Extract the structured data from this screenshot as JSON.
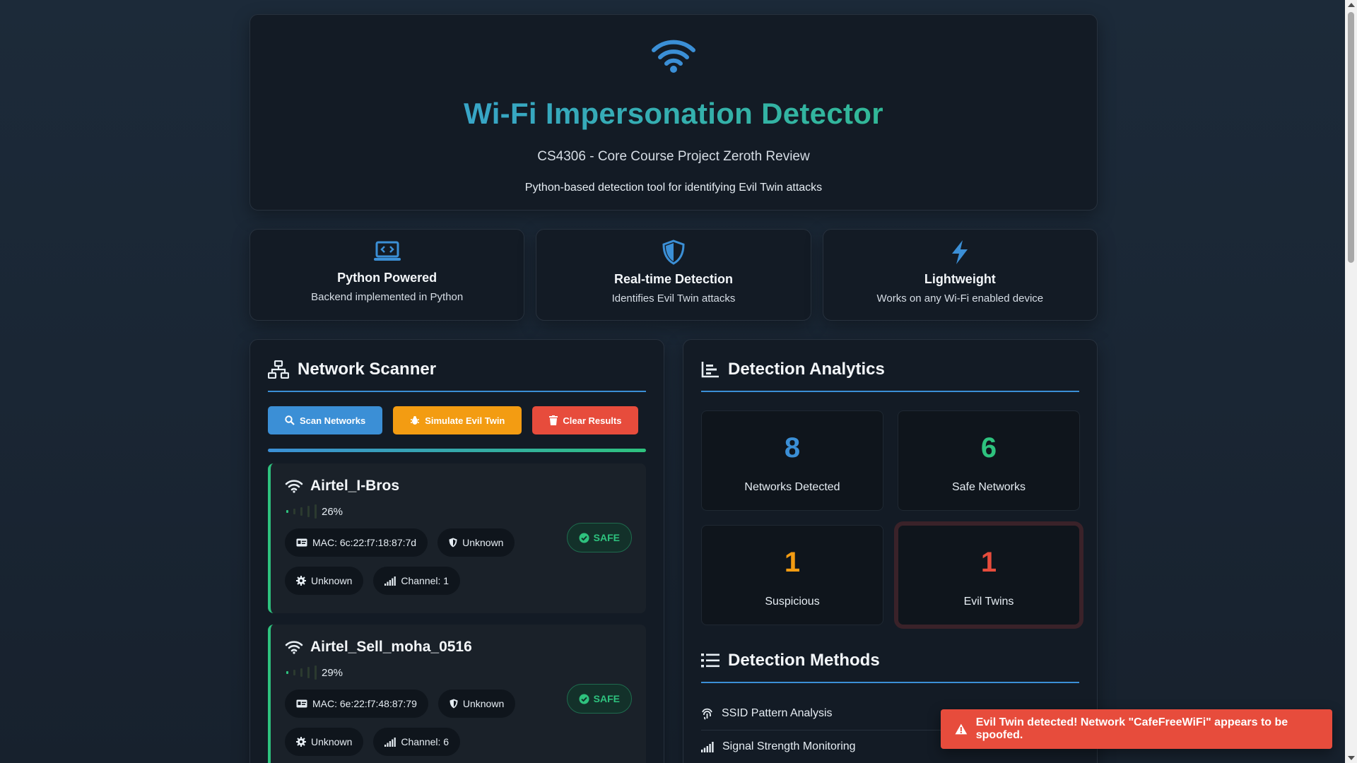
{
  "header": {
    "icon": "wifi-icon",
    "title": "Wi-Fi Impersonation Detector",
    "subtitle": "CS4306 - Core Course Project Zeroth Review",
    "description": "Python-based detection tool for identifying Evil Twin attacks"
  },
  "features": [
    {
      "icon": "laptop-code-icon",
      "title": "Python Powered",
      "subtitle": "Backend implemented in Python"
    },
    {
      "icon": "shield-icon",
      "title": "Real-time Detection",
      "subtitle": "Identifies Evil Twin attacks"
    },
    {
      "icon": "bolt-icon",
      "title": "Lightweight",
      "subtitle": "Works on any Wi-Fi enabled device"
    }
  ],
  "scanner": {
    "title": "Network Scanner",
    "buttons": {
      "scan": "Scan Networks",
      "simulate": "Simulate Evil Twin",
      "clear": "Clear Results"
    },
    "progress_fraction": 1.0,
    "networks": [
      {
        "ssid": "Airtel_I-Bros",
        "signal": "26%",
        "signal_bars": 1,
        "mac": "MAC: 6c:22:f7:18:87:7d",
        "security": "Unknown",
        "encryption": "Unknown",
        "channel": "Channel: 1",
        "status": "SAFE"
      },
      {
        "ssid": "Airtel_Sell_moha_0516",
        "signal": "29%",
        "signal_bars": 1,
        "mac": "MAC: 6e:22:f7:48:87:79",
        "security": "Unknown",
        "encryption": "Unknown",
        "channel": "Channel: 6",
        "status": "SAFE"
      }
    ]
  },
  "analytics": {
    "title": "Detection Analytics",
    "stats": [
      {
        "value": "8",
        "label": "Networks Detected",
        "color": "#3b8fd6"
      },
      {
        "value": "6",
        "label": "Safe Networks",
        "color": "#2ec27e"
      },
      {
        "value": "1",
        "label": "Suspicious",
        "color": "#f39c12"
      },
      {
        "value": "1",
        "label": "Evil Twins",
        "color": "#e74c3c"
      }
    ]
  },
  "methods": {
    "title": "Detection Methods",
    "items": [
      {
        "icon": "fingerprint-icon",
        "label": "SSID Pattern Analysis"
      },
      {
        "icon": "signal-icon",
        "label": "Signal Strength Monitoring"
      }
    ]
  },
  "toast": {
    "message": "Evil Twin detected! Network \"CafeFreeWiFi\" appears to be spoofed."
  },
  "colors": {
    "accent_blue": "#3b8fd6",
    "safe_green": "#2ec27e",
    "warning_orange": "#f39c12",
    "danger_red": "#e74c3c"
  }
}
